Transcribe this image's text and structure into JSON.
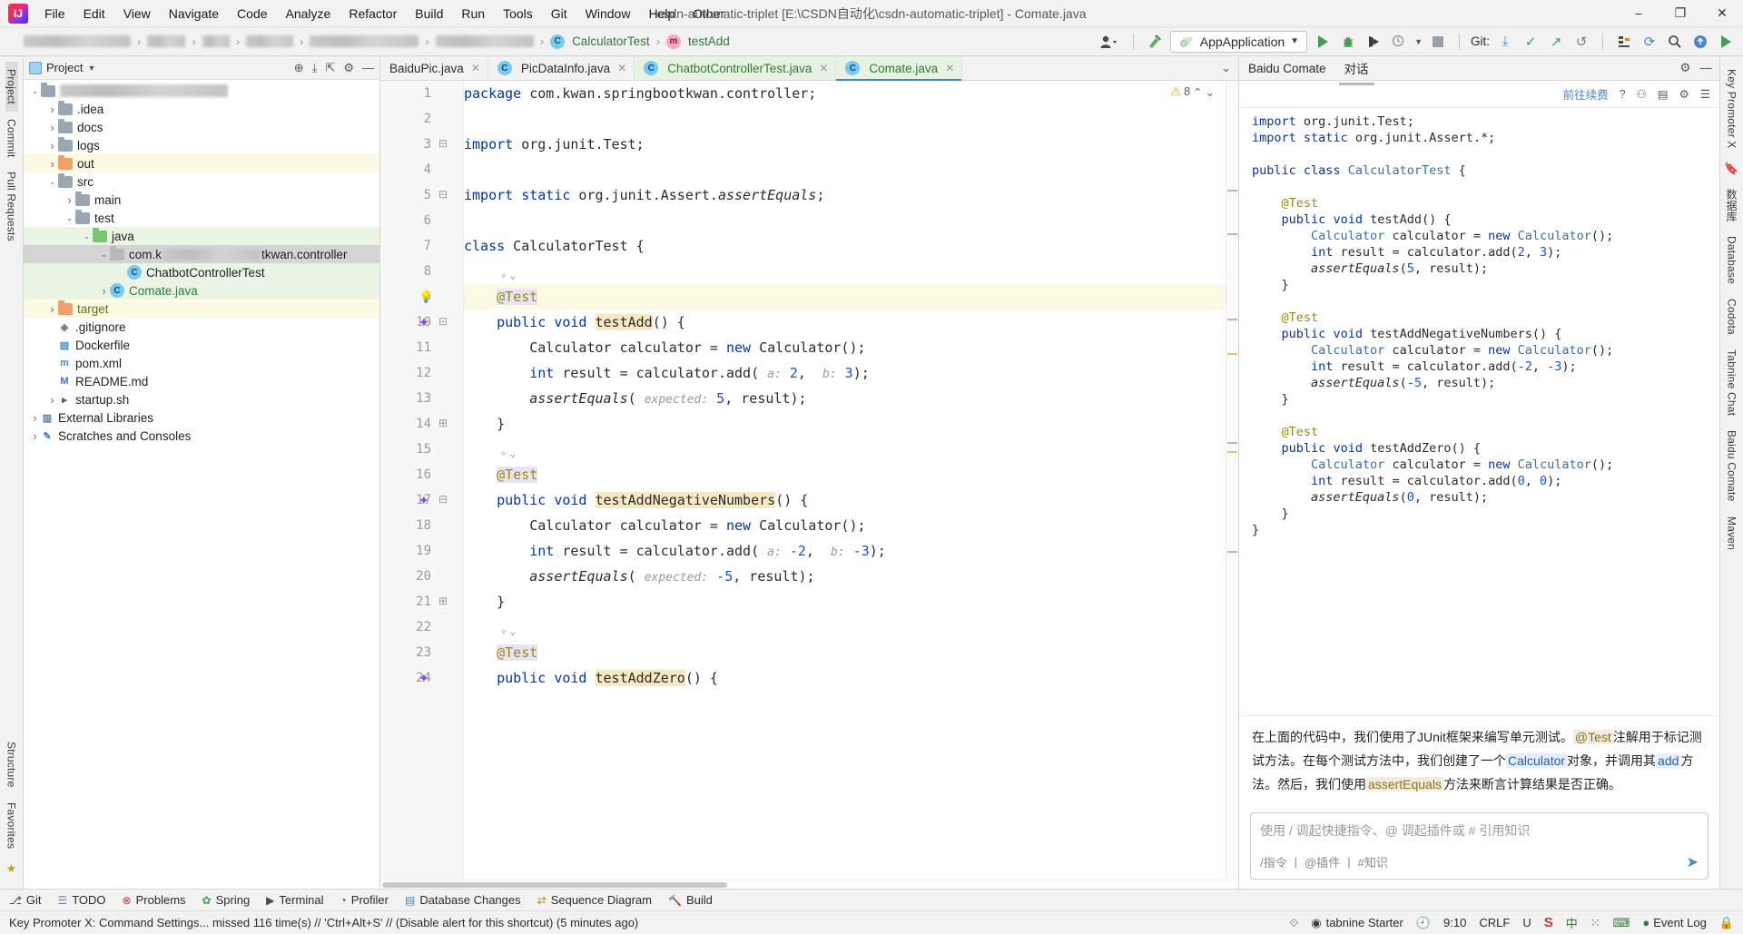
{
  "window": {
    "title": "csdn-automatic-triplet [E:\\CSDN自动化\\csdn-automatic-triplet] - Comate.java",
    "minimize": "−",
    "maximize": "❐",
    "close": "✕"
  },
  "menu": [
    {
      "label": "File"
    },
    {
      "label": "Edit"
    },
    {
      "label": "View"
    },
    {
      "label": "Navigate"
    },
    {
      "label": "Code"
    },
    {
      "label": "Analyze"
    },
    {
      "label": "Refactor"
    },
    {
      "label": "Build"
    },
    {
      "label": "Run"
    },
    {
      "label": "Tools"
    },
    {
      "label": "Git"
    },
    {
      "label": "Window"
    },
    {
      "label": "Help"
    },
    {
      "label": "Other"
    }
  ],
  "toolbar": {
    "breadcrumb_class": "CalculatorTest",
    "breadcrumb_method": "testAdd",
    "class_badge": "C",
    "method_badge": "m",
    "run_config": "AppApplication",
    "git_label": "Git:",
    "avatar_icon": "user-icon",
    "hammer_icon": "build-icon",
    "run_icon": "run-icon",
    "debug_icon": "debug-icon",
    "coverage_icon": "coverage-icon",
    "profile_icon": "profile-icon",
    "stop_icon": "stop-icon",
    "search_icon": "search-icon",
    "update_icon": "update-icon"
  },
  "left_rail": {
    "top": [
      "Project",
      "Commit",
      "Pull Requests"
    ],
    "bottom": [
      "Structure",
      "Favorites"
    ]
  },
  "right_rail": {
    "items": [
      "Key Promoter X",
      "数据库",
      "Database",
      "Codota",
      "Tabnine Chat",
      "Baidu Comate",
      "Maven"
    ]
  },
  "project_panel": {
    "title": "Project",
    "actions": [
      "target-icon",
      "collapse-icon",
      "expand-icon",
      "gear-icon",
      "minimize-icon"
    ],
    "tree": [
      {
        "indent": 0,
        "arrow": "v",
        "type": "blur",
        "label": "",
        "state": "none",
        "blurw": 185
      },
      {
        "indent": 1,
        "arrow": ">",
        "type": "folder",
        "label": ".idea",
        "state": "none"
      },
      {
        "indent": 1,
        "arrow": ">",
        "type": "folder",
        "label": "docs",
        "state": "none"
      },
      {
        "indent": 1,
        "arrow": ">",
        "type": "folder",
        "label": "logs",
        "state": "none"
      },
      {
        "indent": 1,
        "arrow": ">",
        "type": "folder-orange",
        "label": "out",
        "state": "yellow"
      },
      {
        "indent": 1,
        "arrow": "v",
        "type": "folder",
        "label": "src",
        "state": "none"
      },
      {
        "indent": 2,
        "arrow": ">",
        "type": "folder",
        "label": "main",
        "state": "none"
      },
      {
        "indent": 2,
        "arrow": "v",
        "type": "folder",
        "label": "test",
        "state": "none"
      },
      {
        "indent": 3,
        "arrow": "v",
        "type": "folder-green",
        "label": "java",
        "state": "green"
      },
      {
        "indent": 4,
        "arrow": "v",
        "type": "package",
        "label": "com.k",
        "label2": "tkwan.controller",
        "state": "gray",
        "blurw": 108
      },
      {
        "indent": 5,
        "arrow": "",
        "type": "class-test",
        "label": "ChatbotControllerTest",
        "state": "green"
      },
      {
        "indent": 4,
        "arrow": ">",
        "type": "class",
        "label": "Comate.java",
        "state": "green",
        "green_text": true
      },
      {
        "indent": 1,
        "arrow": ">",
        "type": "folder-orange",
        "label": "target",
        "state": "yellow",
        "olive": true
      },
      {
        "indent": 1,
        "arrow": "",
        "type": "file-git",
        "label": ".gitignore",
        "state": "none"
      },
      {
        "indent": 1,
        "arrow": "",
        "type": "file-docker",
        "label": "Dockerfile",
        "state": "none"
      },
      {
        "indent": 1,
        "arrow": "",
        "type": "file-maven",
        "label": "pom.xml",
        "state": "none"
      },
      {
        "indent": 1,
        "arrow": "",
        "type": "file-md",
        "label": "README.md",
        "state": "none"
      },
      {
        "indent": 1,
        "arrow": ">",
        "type": "file-sh",
        "label": "startup.sh",
        "state": "none"
      },
      {
        "indent": 0,
        "arrow": ">",
        "type": "libs",
        "label": "External Libraries",
        "state": "none"
      },
      {
        "indent": 0,
        "arrow": ">",
        "type": "scratch",
        "label": "Scratches and Consoles",
        "state": "none"
      }
    ]
  },
  "editor": {
    "tabs": [
      {
        "label": "BaiduPic.java",
        "active": false,
        "icon": "",
        "close": "✕"
      },
      {
        "label": "PicDataInfo.java",
        "active": false,
        "icon": "C",
        "close": "✕"
      },
      {
        "label": "ChatbotControllerTest.java",
        "active": false,
        "icon": "C",
        "close": "✕"
      },
      {
        "label": "Comate.java",
        "active": true,
        "icon": "C",
        "close": "✕"
      }
    ],
    "tabs_overflow": "⌄",
    "inspection_count": "8",
    "inspection_icon": "warning-triangle-icon",
    "line_numbers": [
      "1",
      "2",
      "3",
      "4",
      "5",
      "6",
      "7",
      "8",
      "9",
      "10",
      "11",
      "12",
      "13",
      "14",
      "15",
      "16",
      "17",
      "18",
      "19",
      "20",
      "21",
      "22",
      "23",
      "24"
    ],
    "code_lines": [
      {
        "n": 1,
        "html": "package com.kwan.springbootkwan.controller;"
      },
      {
        "n": 2,
        "html": ""
      },
      {
        "n": 3,
        "html": "import org.junit.Test;"
      },
      {
        "n": 4,
        "html": ""
      },
      {
        "n": 5,
        "html": "import static org.junit.Assert.assertEquals;"
      },
      {
        "n": 6,
        "html": ""
      },
      {
        "n": 7,
        "html": "class CalculatorTest {"
      },
      {
        "n": 8,
        "html": ""
      },
      {
        "n": 9,
        "html": "    @Test"
      },
      {
        "n": 10,
        "html": "    public void testAdd() {"
      },
      {
        "n": 11,
        "html": "        Calculator calculator = new Calculator();"
      },
      {
        "n": 12,
        "html": "        int result = calculator.add( a: 2,  b: 3);"
      },
      {
        "n": 13,
        "html": "        assertEquals( expected: 5, result);"
      },
      {
        "n": 14,
        "html": "    }"
      },
      {
        "n": 15,
        "html": ""
      },
      {
        "n": 16,
        "html": "    @Test"
      },
      {
        "n": 17,
        "html": "    public void testAddNegativeNumbers() {"
      },
      {
        "n": 18,
        "html": "        Calculator calculator = new Calculator();"
      },
      {
        "n": 19,
        "html": "        int result = calculator.add( a: -2,  b: -3);"
      },
      {
        "n": 20,
        "html": "        assertEquals( expected: -5, result);"
      },
      {
        "n": 21,
        "html": "    }"
      },
      {
        "n": 22,
        "html": ""
      },
      {
        "n": 23,
        "html": "    @Test"
      },
      {
        "n": 24,
        "html": "    public void testAddZero() {"
      }
    ]
  },
  "comate": {
    "tab_main": "Baidu Comate",
    "tab_chat": "对话",
    "header_actions": [
      "gear-icon",
      "minimize-icon"
    ],
    "sub_actions": {
      "renew": "前往续费",
      "icons": [
        "help-icon",
        "account-icon",
        "layout-icon",
        "settings-icon",
        "menu-icon"
      ]
    },
    "code": [
      "import org.junit.Test;",
      "import static org.junit.Assert.*;",
      "",
      "public class CalculatorTest {",
      "",
      "    @Test",
      "    public void testAdd() {",
      "        Calculator calculator = new Calculator();",
      "        int result = calculator.add(2, 3);",
      "        assertEquals(5, result);",
      "    }",
      "",
      "    @Test",
      "    public void testAddNegativeNumbers() {",
      "        Calculator calculator = new Calculator();",
      "        int result = calculator.add(-2, -3);",
      "        assertEquals(-5, result);",
      "    }",
      "",
      "    @Test",
      "    public void testAddZero() {",
      "        Calculator calculator = new Calculator();",
      "        int result = calculator.add(0, 0);",
      "        assertEquals(0, result);",
      "    }",
      "}"
    ],
    "explain_1": "在上面的代码中，我们使用了JUnit框架来编写单元测试。",
    "explain_code_1": "@Test",
    "explain_2": "注解用于标记测",
    "explain_3": "试方法。在每个测试方法中，我们创建了一个",
    "explain_code_2": "Calculator",
    "explain_4": "对象，并调用其",
    "explain_code_3": "add",
    "explain_5": "方",
    "explain_6": "法。然后，我们使用",
    "explain_code_4": "assertEquals",
    "explain_7": "方法来断言计算结果是否正确。",
    "input_placeholder": "使用 / 调起快捷指令、@ 调起插件或 # 引用知识",
    "chips": [
      "/指令",
      "@插件",
      "#知识"
    ],
    "send_icon": "send-icon"
  },
  "bottom_tools": [
    {
      "label": "Git",
      "icon": "git-icon"
    },
    {
      "label": "TODO",
      "icon": "todo-icon"
    },
    {
      "label": "Problems",
      "icon": "problems-icon"
    },
    {
      "label": "Spring",
      "icon": "spring-icon"
    },
    {
      "label": "Terminal",
      "icon": "terminal-icon"
    },
    {
      "label": "Profiler",
      "icon": "profiler-icon"
    },
    {
      "label": "Database Changes",
      "icon": "database-icon"
    },
    {
      "label": "Sequence Diagram",
      "icon": "sequence-icon"
    },
    {
      "label": "Build",
      "icon": "build-icon"
    }
  ],
  "status": {
    "message": "Key Promoter X: Command Settings... missed 116 time(s) // 'Ctrl+Alt+S' // (Disable alert for this shortcut) (5 minutes ago)",
    "tabnine": "tabnine Starter",
    "position": "9:10",
    "line_ending": "CRLF",
    "encoding": "U",
    "event_log": "Event Log",
    "ime": "中",
    "lock_icon": "lock-icon",
    "notify_icon": "bell-icon"
  }
}
